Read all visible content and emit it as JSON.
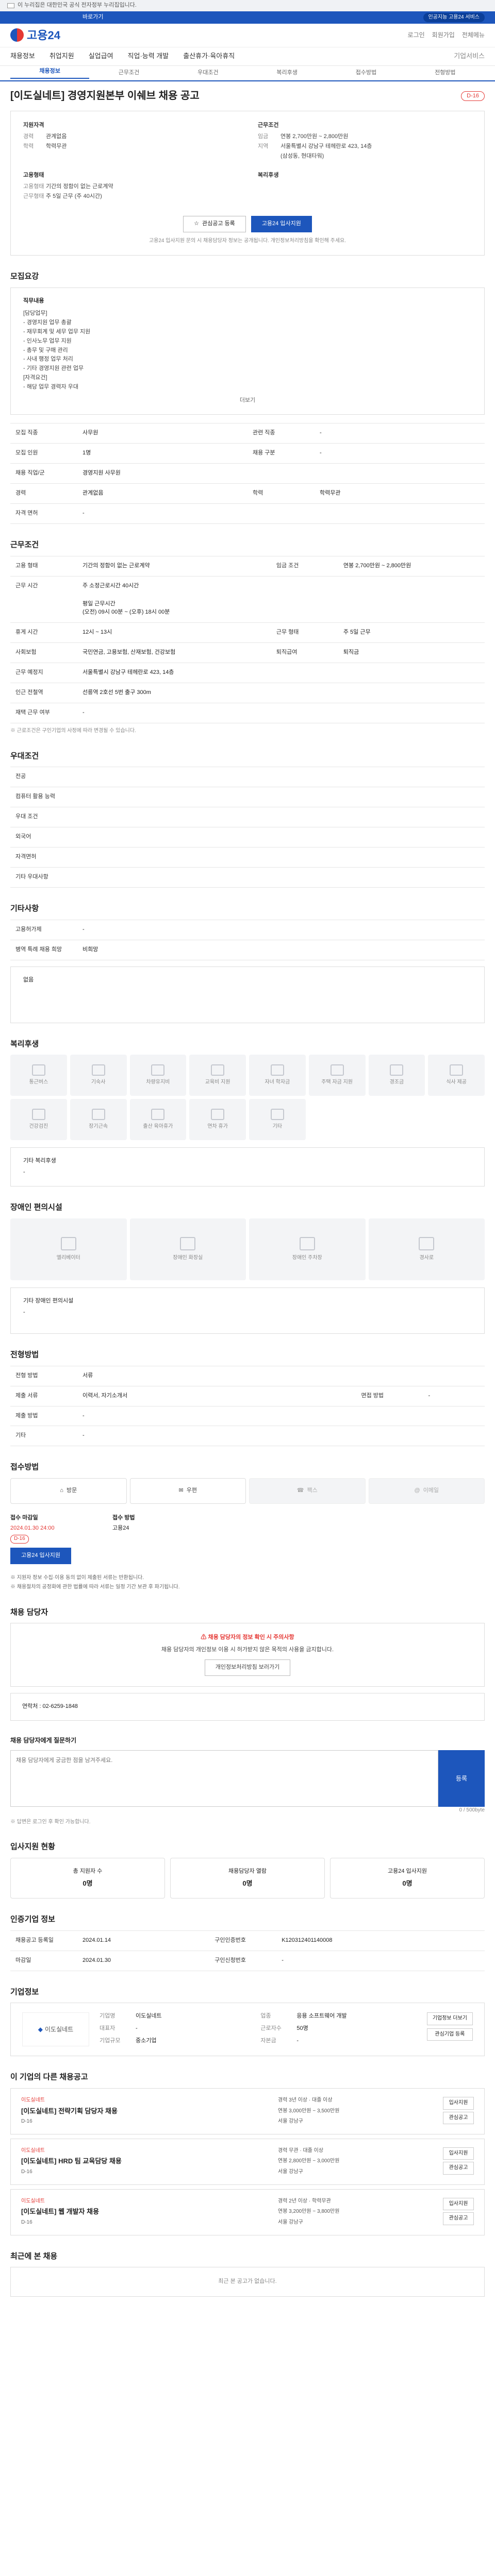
{
  "gov": {
    "text": "이 누리집은 대한민국 공식 전자정부 누리집입니다."
  },
  "strip": {
    "mid": "바로가기",
    "right": "인공지능 고용24 서비스"
  },
  "header": {
    "logo": "고용24",
    "links": [
      "로그인",
      "회원가입",
      "전체메뉴"
    ]
  },
  "nav": {
    "items": [
      "채용정보",
      "취업지원",
      "실업급여",
      "직업·능력 개발",
      "출산휴가·육아휴직"
    ],
    "right": "기업서비스"
  },
  "subnav": {
    "items": [
      "채용정보",
      "근무조건",
      "우대조건",
      "복리후생",
      "접수방법",
      "전형방법"
    ]
  },
  "title": {
    "text": "[이도실네트] 경영지원본부 이쉐브 채용 공고",
    "badge": "D-16"
  },
  "summary": {
    "left_title": "지원자격",
    "left_rows": [
      [
        "경력",
        "관계없음"
      ],
      [
        "학력",
        "학력무관"
      ]
    ],
    "right_title": "근무조건",
    "right_rows": [
      [
        "임금",
        "연봉 2,700만원 ~ 2,800만원"
      ],
      [
        "지역",
        "서울특별시 강남구 테헤란로 423, 14층"
      ],
      [
        "",
        "(삼성동, 현대타워)"
      ]
    ],
    "left2_title": "고용형태",
    "left2_rows": [
      [
        "고용형태",
        "기간의 정함이 없는 근로계약"
      ],
      [
        "근무형태",
        "주 5일 근무 (주 40시간)"
      ]
    ],
    "right2_title": "복리후생",
    "right2_rows": [],
    "btn_scrap": "관심공고 등록",
    "btn_apply": "고용24 입사지원",
    "note": "고용24 입사지원 문의 시 채용담당자 정보는 공개됩니다. 개인정보처리방침을 확인해 주세요."
  },
  "duty": {
    "title": "모집요강",
    "head": "직무내용",
    "lines": [
      "[담당업무]",
      "- 경영지원 업무 총괄",
      "- 재무회계 및 세무 업무 지원",
      "- 인사노무 업무 지원",
      "- 총무 및 구매 관리",
      "- 사내 행정 업무 처리",
      "- 기타 경영지원 관련 업무",
      "[자격요건]",
      "- 해당 업무 경력자 우대"
    ],
    "more": "더보기"
  },
  "cond": {
    "rows": [
      [
        "모집 직종",
        "사무원",
        "관련 직종",
        "-"
      ],
      [
        "모집 인원",
        "1명",
        "채용 구분",
        "-"
      ],
      [
        "채용 직업/군",
        "경영지원 사무원",
        "",
        ""
      ],
      [
        "경력",
        "관계없음",
        "학력",
        "학력무관"
      ],
      [
        "자격 면허",
        "-",
        "",
        ""
      ]
    ]
  },
  "work": {
    "title": "근무조건",
    "rows": [
      [
        "고용 형태",
        "기간의 정함이 없는 근로계약",
        "임금 조건",
        "연봉 2,700만원 ~ 2,800만원"
      ],
      [
        "근무 시간",
        "주 소정근로시간 40시간",
        "",
        ""
      ],
      [
        "",
        "평일 근무시간",
        "",
        ""
      ],
      [
        "",
        "(오전) 09시 00분 ~ (오후) 18시 00분",
        "",
        ""
      ],
      [
        "휴게 시간",
        "12시 ~ 13시",
        "근무 형태",
        "주 5일 근무"
      ],
      [
        "사회보험",
        "국민연금, 고용보험, 산재보험, 건강보험",
        "퇴직급여",
        "퇴직금"
      ],
      [
        "근무 예정지",
        "서울특별시 강남구 테헤란로 423, 14층",
        "",
        ""
      ],
      [
        "인근 전철역",
        "선릉역 2호선 5번 출구 300m",
        "",
        ""
      ],
      [
        "재택 근무 여부",
        "-",
        "",
        ""
      ]
    ],
    "note": "※ 근로조건은 구인기업의 사정에 따라 변경될 수 있습니다."
  },
  "pref": {
    "title": "우대조건",
    "rows": [
      [
        "전공",
        ""
      ],
      [
        "컴퓨터 활용 능력",
        ""
      ],
      [
        "우대 조건",
        ""
      ],
      [
        "외국어",
        ""
      ],
      [
        "자격면허",
        ""
      ],
      [
        "기타 우대사항",
        ""
      ]
    ]
  },
  "etc": {
    "title": "기타사항",
    "rows": [
      [
        "고용허가제",
        "-"
      ],
      [
        "병역 특례 채용 희망",
        "비희망"
      ]
    ],
    "box": "없음"
  },
  "welfare": {
    "title": "복리후생",
    "items": [
      "통근버스",
      "기숙사",
      "차량유지비",
      "교육비 지원",
      "자녀 학자금",
      "주택 자금 지원",
      "경조금",
      "식사 제공",
      "건강검진",
      "장기근속",
      "출산 육아휴가",
      "연차 휴가",
      "기타"
    ],
    "extra_label": "기타 복리후생",
    "extra": "-"
  },
  "disab": {
    "title": "장애인 편의시설",
    "items": [
      "엘리베이터",
      "장애인 화장실",
      "장애인 주차장",
      "경사로"
    ],
    "extra_label": "기타 장애인 편의시설",
    "extra": "-"
  },
  "screen": {
    "title": "전형방법",
    "rows": [
      [
        "전형 방법",
        "서류",
        "",
        ""
      ],
      [
        "제출 서류",
        "이력서, 자기소개서",
        "면접 방법",
        "-"
      ],
      [
        "제출 방법",
        "-",
        "",
        ""
      ],
      [
        "기타",
        "-",
        "",
        ""
      ]
    ]
  },
  "apply": {
    "title": "접수방법",
    "methods": [
      "방문",
      "우편",
      "팩스",
      "이메일"
    ],
    "deadline_label": "접수 마감일",
    "deadline": "2024.01.30 24:00",
    "dday": "D-16",
    "method_label": "접수 방법",
    "method": "고용24",
    "btn": "고용24 입사지원",
    "notes": [
      "※ 지원자 정보 수집·이용 동의 없이 제출된 서류는 반환됩니다.",
      "※ 채용절차의 공정화에 관한 법률에 따라 서류는 일정 기간 보관 후 파기됩니다."
    ]
  },
  "contact": {
    "title": "채용 담당자",
    "warn_head": "채용 담당자의 정보 확인 시 주의사항",
    "warn_body": "채용 담당자의 개인정보 이용 시 허가받지 않은 목적의 사용을 금지합니다.",
    "btn": "개인정보처리방침 보러가기",
    "phone_label": "연락처",
    "phone": "02-6259-1848"
  },
  "qna": {
    "title": "채용 담당자에게 질문하기",
    "placeholder": "채용 담당자에게 궁금한 점을 남겨주세요.",
    "count": "0 / 500byte",
    "btn": "등록",
    "note": "※ 답변은 로그인 후 확인 가능합니다."
  },
  "status": {
    "title": "입사지원 현황",
    "items": [
      [
        "총 지원자 수",
        "0명"
      ],
      [
        "채용담당자 열람",
        "0명"
      ],
      [
        "고용24 입사지원",
        "0명"
      ]
    ]
  },
  "info": {
    "title": "인증기업 정보",
    "rows": [
      [
        "채용공고 등록일",
        "2024.01.14",
        "구인인증번호",
        "K120312401140008"
      ],
      [
        "마감일",
        "2024.01.30",
        "구인신청번호",
        "-"
      ]
    ]
  },
  "corp": {
    "title": "기업정보",
    "name": "이도실네트",
    "rows": [
      [
        "기업명",
        "이도실네트",
        "업종",
        "응용 소프트웨어 개발"
      ],
      [
        "대표자",
        "-",
        "근로자수",
        "50명"
      ],
      [
        "기업규모",
        "중소기업",
        "자본금",
        "-"
      ]
    ],
    "btns": [
      "기업정보 더보기",
      "관심기업 등록"
    ]
  },
  "jobs": {
    "title": "이 기업의 다른 채용공고",
    "list": [
      {
        "co": "이도실네트",
        "t": "[이도실네트] 전략기획 담당자 채용",
        "meta": "경력 3년 이상 · 대졸 이상",
        "pay": "연봉 3,000만원 ~ 3,500만원",
        "loc": "서울 강남구",
        "dd": "D-16"
      },
      {
        "co": "이도실네트",
        "t": "[이도실네트] HRD 팀 교육담당 채용",
        "meta": "경력 무관 · 대졸 이상",
        "pay": "연봉 2,800만원 ~ 3,000만원",
        "loc": "서울 강남구",
        "dd": "D-16"
      },
      {
        "co": "이도실네트",
        "t": "[이도실네트] 웹 개발자 채용",
        "meta": "경력 2년 이상 · 학력무관",
        "pay": "연봉 3,200만원 ~ 3,800만원",
        "loc": "서울 강남구",
        "dd": "D-16"
      }
    ],
    "acts": [
      "입사지원",
      "관심공고"
    ]
  },
  "recent": {
    "title": "최근에 본 채용",
    "empty": "최근 본 공고가 없습니다."
  }
}
